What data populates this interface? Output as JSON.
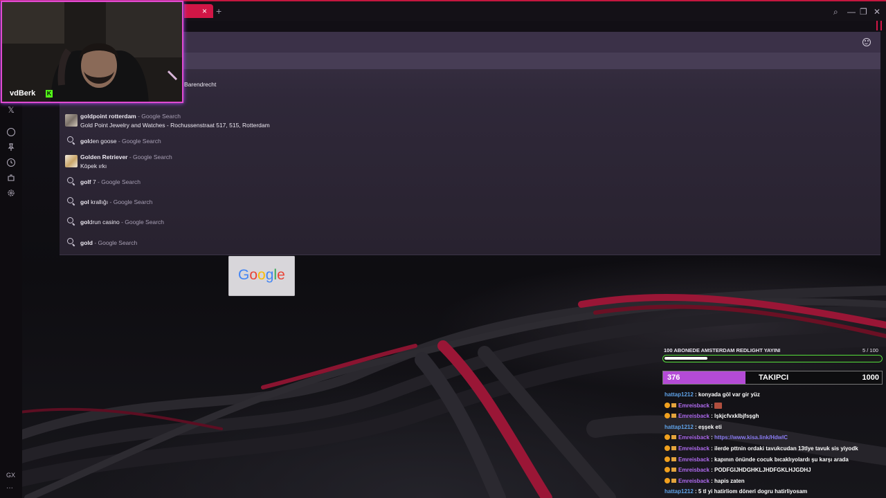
{
  "browser": {
    "tab_close": "×",
    "new_tab": "+",
    "window_controls": {
      "search": "⌕",
      "minimize": "—",
      "maximize": "❐",
      "close": "✕"
    }
  },
  "sidebar": {
    "icons": [
      "x-icon",
      "player-icon",
      "pin-icon",
      "history-icon",
      "extensions-icon",
      "settings-icon"
    ],
    "x_glyph": "𝕏",
    "bottom_label": "GX",
    "more": "···"
  },
  "webcam": {
    "name": "vdBerk",
    "platform_badge": "K",
    "partial_text": "Barendrecht"
  },
  "suggestions": [
    {
      "type": "rich",
      "bold": "goldpoint rotterdam",
      "suffix": " - Google Search",
      "sub": "Gold Point Jewelry and Watches - Rochussenstraat 517, 515, Rotterdam",
      "thumb": "gold"
    },
    {
      "type": "search",
      "bold": "gol",
      "rest": "den goose",
      "suffix": " - Google Search"
    },
    {
      "type": "rich",
      "bold": "Golden Retriever",
      "suffix": " - Google Search",
      "sub": "Köpek ırkı",
      "thumb": "dog"
    },
    {
      "type": "search",
      "bold": "golf",
      "rest": " 7",
      "suffix": " - Google Search"
    },
    {
      "type": "search",
      "bold": "gol",
      "rest": " krallığı",
      "suffix": " - Google Search"
    },
    {
      "type": "search",
      "bold": "gol",
      "rest": "drun casino",
      "suffix": " - Google Search"
    },
    {
      "type": "search",
      "bold": "gold",
      "rest": "",
      "suffix": " - Google Search"
    }
  ],
  "speed_dial": {
    "google_letters": [
      "G",
      "o",
      "o",
      "g",
      "l",
      "e"
    ],
    "google_colors": [
      "#4285f4",
      "#ea4335",
      "#fbbc05",
      "#4285f4",
      "#34a853",
      "#ea4335"
    ]
  },
  "stream_overlay": {
    "goal": {
      "label": "100 ABONEDE AMSTERDAM REDLIGHT YAYINI",
      "count": "5  / 100",
      "progress": 0.05
    },
    "followers": {
      "current": "376",
      "title": "TAKIPCI",
      "target": "1000",
      "progress": 0.376
    },
    "chat": [
      {
        "user": "hattap1212",
        "color": "blue",
        "badges": false,
        "text": " : konyada göl var gir yüz"
      },
      {
        "user": "Emreisback",
        "color": "purple",
        "badges": true,
        "text": " : ",
        "emote": true
      },
      {
        "user": "Emreisback",
        "color": "purple",
        "badges": true,
        "text": " : lşkjcfvxklbjfsşgh"
      },
      {
        "user": "hattap1212",
        "color": "blue",
        "badges": false,
        "text": " : eşşek eti"
      },
      {
        "user": "Emreisback",
        "color": "purple",
        "badges": true,
        "text": " : ",
        "link": "https://www.kisa.link/HdwlC"
      },
      {
        "user": "Emreisback",
        "color": "purple",
        "badges": true,
        "text": " : ilerde pttnin ordaki tavukcudan 13tlye tavuk sis yiyodk"
      },
      {
        "user": "Emreisback",
        "color": "purple",
        "badges": true,
        "text": " : kapının önünde cocuk bıcaklıyolardı şu karşı arada"
      },
      {
        "user": "Emreisback",
        "color": "purple",
        "badges": true,
        "text": " : PODFGIJHDGHKLJHDFGKLHJGDHJ"
      },
      {
        "user": "Emreisback",
        "color": "purple",
        "badges": true,
        "text": " : hapis zaten"
      },
      {
        "user": "hattap1212",
        "color": "blue",
        "badges": false,
        "text": " : 5 tl yi hatirliom döneri dogru hatirliyosam"
      }
    ]
  }
}
